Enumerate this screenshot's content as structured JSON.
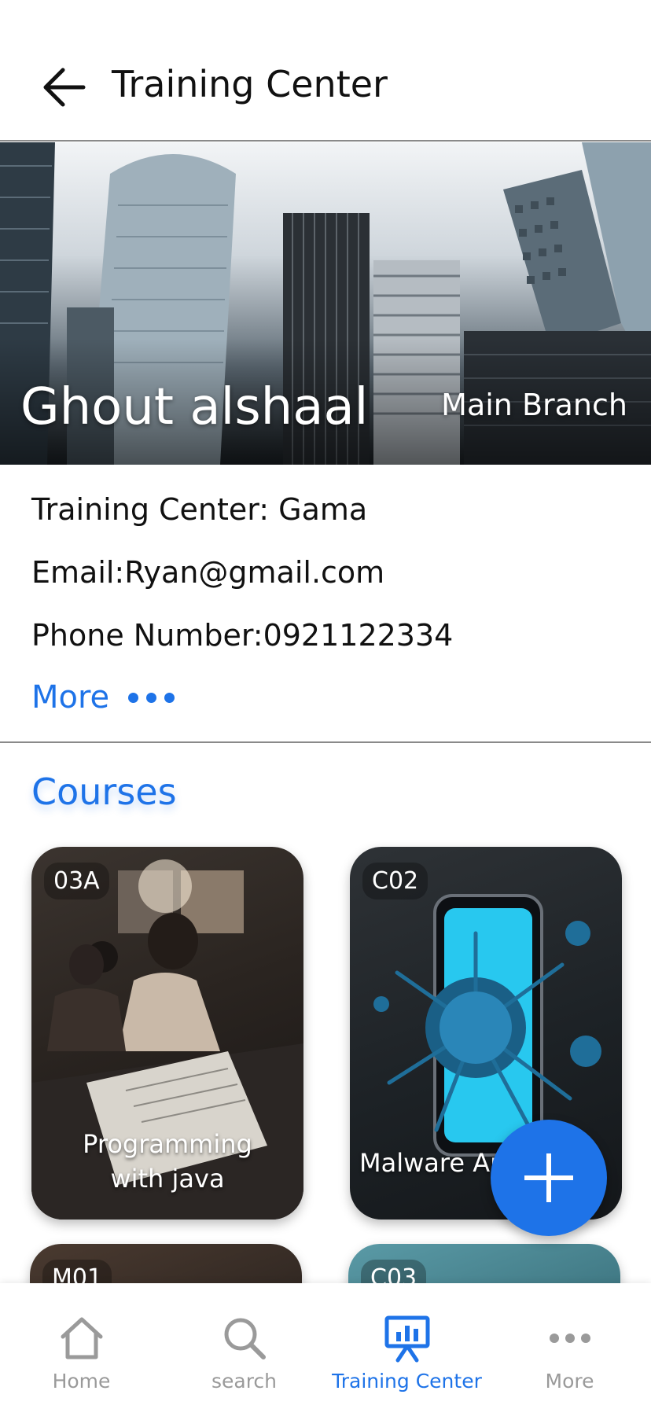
{
  "app_bar": {
    "title": "Training Center"
  },
  "hero": {
    "name": "Ghout alshaal",
    "branch": "Main Branch"
  },
  "info": {
    "training_center": "Training Center: Gama",
    "email": "Email:Ryan@gmail.com",
    "phone": "Phone Number:0921122334",
    "more_label": "More"
  },
  "courses_title": "Courses",
  "courses": [
    {
      "code": "03A",
      "title_line1": "Programming",
      "title_line2": "with java"
    },
    {
      "code": "C02",
      "title_line1": "Malware An",
      "title_line2": ""
    },
    {
      "code": "M01"
    },
    {
      "code": "C03"
    }
  ],
  "fab_icon": "plus-icon",
  "bottom_nav": [
    {
      "label": "Home",
      "icon": "home-icon"
    },
    {
      "label": "search",
      "icon": "search-icon"
    },
    {
      "label": "Training Center",
      "icon": "presentation-icon",
      "active": true
    },
    {
      "label": "More",
      "icon": "more-icon"
    }
  ],
  "colors": {
    "accent": "#1e73e8",
    "inactive": "#9a9a9a",
    "text": "#111111"
  }
}
